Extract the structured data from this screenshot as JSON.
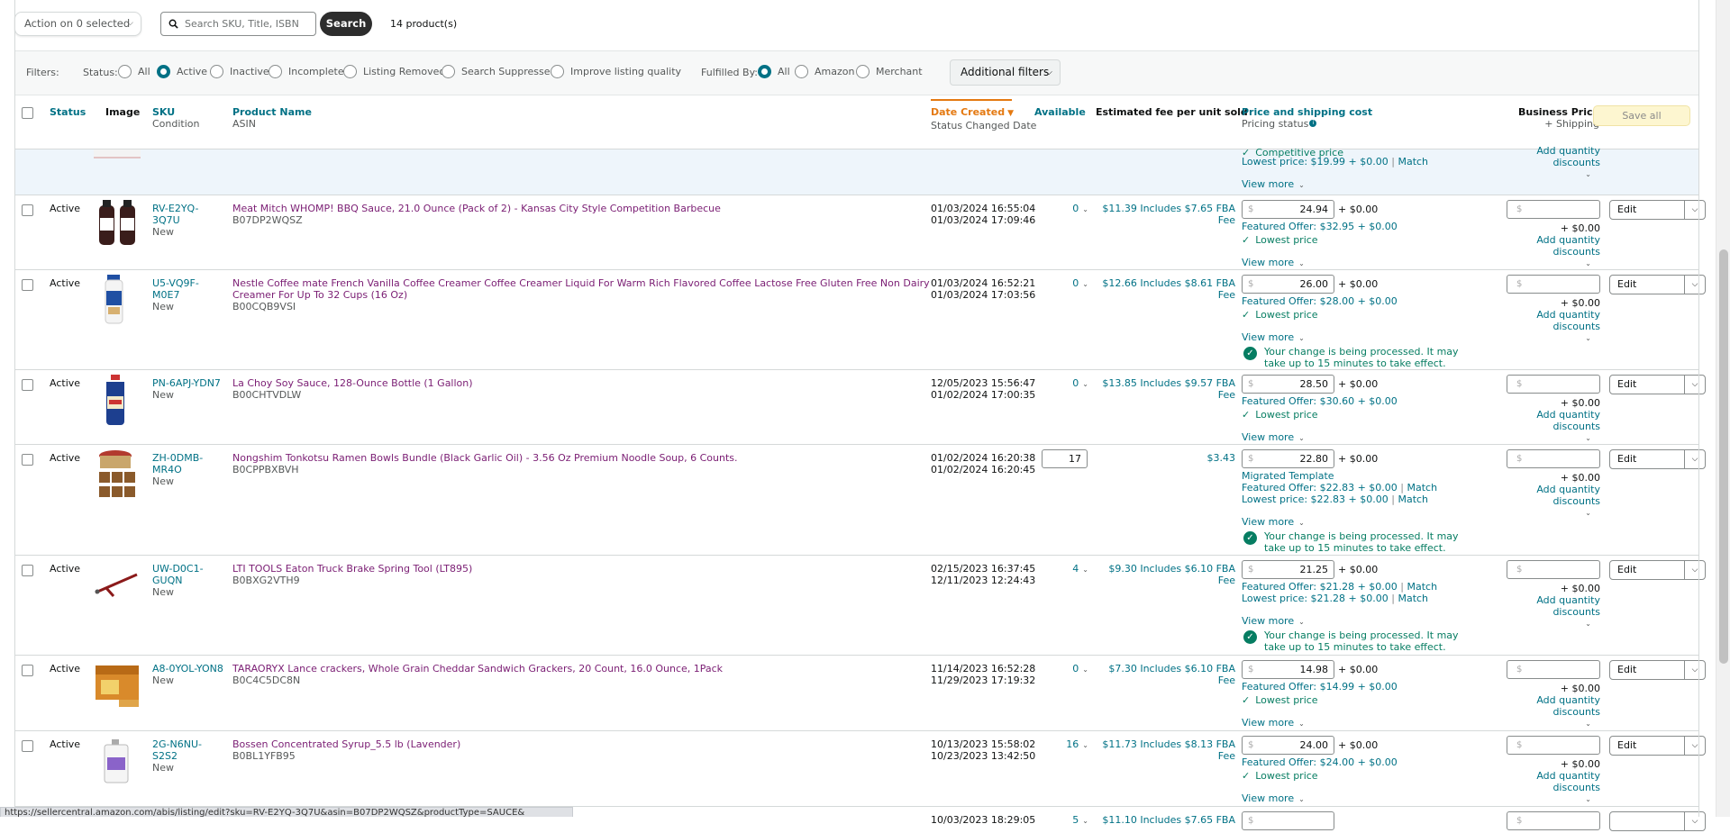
{
  "toolbar": {
    "action_label": "Action on 0 selected",
    "search_placeholder": "Search SKU, Title, ISBN",
    "search_button": "Search",
    "product_count": "14 product(s)"
  },
  "filters": {
    "label": "Filters:",
    "status_label": "Status:",
    "status_options": [
      "All",
      "Active",
      "Inactive",
      "Incomplete",
      "Listing Removed",
      "Search Suppressed",
      "Improve listing quality"
    ],
    "status_selected": "Active",
    "fulfilled_label": "Fulfilled By:",
    "fulfilled_options": [
      "All",
      "Amazon",
      "Merchant"
    ],
    "fulfilled_selected": "All",
    "additional_filters": "Additional filters"
  },
  "table_header": {
    "status": "Status",
    "image": "Image",
    "sku": "SKU",
    "condition": "Condition",
    "product_name": "Product Name",
    "asin": "ASIN",
    "date_created": "Date Created",
    "status_changed": "Status Changed Date",
    "available": "Available",
    "est_fee": "Estimated fee per unit sold",
    "price_shipping": "Price and shipping cost",
    "pricing_status": "Pricing status",
    "business_price": "Business Price",
    "plus_shipping": "+ Shipping",
    "save_all": "Save all"
  },
  "partial_row": {
    "competitive": "Competitive price",
    "lowest": "Lowest price: $19.99 + $0.00",
    "match": "Match",
    "view_more": "View more",
    "aqd": "Add quantity discounts"
  },
  "rows": [
    {
      "status": "Active",
      "sku": "RV-E2YQ-3Q7U",
      "condition": "New",
      "name": "Meat Mitch WHOMP! BBQ Sauce, 21.0 Ounce (Pack of 2) - Kansas City Style Competition Barbecue",
      "asin": "B07DP2WQSZ",
      "created": "01/03/2024 16:55:04",
      "changed": "01/03/2024 17:09:46",
      "available": "0",
      "fee": "$11.39 Includes $7.65 FBA Fee",
      "price": "24.94",
      "shipping": "+ $0.00",
      "featured": "Featured Offer: $32.95 + $0.00",
      "lowest_label": "Lowest price",
      "view_more": "View more",
      "bp_ship": "+ $0.00",
      "aqd": "Add quantity discounts",
      "edit": "Edit"
    },
    {
      "status": "Active",
      "sku": "U5-VQ9F-M0E7",
      "condition": "New",
      "name": "Nestle Coffee mate French Vanilla Coffee Creamer Coffee Creamer Liquid For Warm Rich Flavored Coffee Lactose Free Gluten Free Non Dairy Creamer For Up To 32 Cups (16 Oz)",
      "asin": "B00CQB9VSI",
      "created": "01/03/2024 16:52:21",
      "changed": "01/03/2024 17:03:56",
      "available": "0",
      "fee": "$12.66 Includes $8.61 FBA Fee",
      "price": "26.00",
      "shipping": "+ $0.00",
      "featured": "Featured Offer: $28.00 + $0.00",
      "lowest_label": "Lowest price",
      "view_more": "View more",
      "msg": "Your change is being processed. It may take up to 15 minutes to take effect.",
      "bp_ship": "+ $0.00",
      "aqd": "Add quantity discounts",
      "edit": "Edit"
    },
    {
      "status": "Active",
      "sku": "PN-6APJ-YDN7",
      "condition": "New",
      "name": "La Choy Soy Sauce, 128-Ounce Bottle (1 Gallon)",
      "asin": "B00CHTVDLW",
      "created": "12/05/2023 15:56:47",
      "changed": "01/02/2024 17:00:35",
      "available": "0",
      "fee": "$13.85 Includes $9.57 FBA Fee",
      "price": "28.50",
      "shipping": "+ $0.00",
      "featured": "Featured Offer: $30.60 + $0.00",
      "lowest_label": "Lowest price",
      "view_more": "View more",
      "bp_ship": "+ $0.00",
      "aqd": "Add quantity discounts",
      "edit": "Edit"
    },
    {
      "status": "Active",
      "sku": "ZH-0DMB-MR4O",
      "condition": "New",
      "name": "Nongshim Tonkotsu Ramen Bowls Bundle (Black Garlic Oil) - 3.56 Oz Premium Noodle Soup, 6 Counts.",
      "asin": "B0CPPBXBVH",
      "created": "01/02/2024 16:20:38",
      "changed": "01/02/2024 16:20:45",
      "available": "17",
      "fee": "$3.43",
      "price": "22.80",
      "shipping": "+ $0.00",
      "template": "Migrated Template",
      "featured": "Featured Offer: $22.83 + $0.00",
      "featured_match": "Match",
      "lowest_text": "Lowest price: $22.83 + $0.00",
      "lowest_match": "Match",
      "view_more": "View more",
      "msg": "Your change is being processed. It may take up to 15 minutes to take effect.",
      "bp_ship": "+ $0.00",
      "aqd": "Add quantity discounts",
      "edit": "Edit"
    },
    {
      "status": "Active",
      "sku": "UW-D0C1-GUQN",
      "condition": "New",
      "name": "LTI TOOLS Eaton Truck Brake Spring Tool (LT895)",
      "asin": "B0BXG2VTH9",
      "created": "02/15/2023 16:37:45",
      "changed": "12/11/2023 12:24:43",
      "available": "4",
      "fee": "$9.30 Includes $6.10 FBA Fee",
      "price": "21.25",
      "shipping": "+ $0.00",
      "featured": "Featured Offer: $21.28 + $0.00",
      "featured_match": "Match",
      "lowest_text": "Lowest price: $21.28 + $0.00",
      "lowest_match": "Match",
      "view_more": "View more",
      "msg": "Your change is being processed. It may take up to 15 minutes to take effect.",
      "bp_ship": "+ $0.00",
      "aqd": "Add quantity discounts",
      "edit": "Edit"
    },
    {
      "status": "Active",
      "sku": "A8-0YOL-YON8",
      "condition": "New",
      "name": "TARAORYX Lance crackers, Whole Grain Cheddar Sandwich Grackers, 20 Count, 16.0 Ounce, 1Pack",
      "asin": "B0C4C5DC8N",
      "created": "11/14/2023 16:52:28",
      "changed": "11/29/2023 17:19:32",
      "available": "0",
      "fee": "$7.30 Includes $6.10 FBA Fee",
      "price": "14.98",
      "shipping": "+ $0.00",
      "featured": "Featured Offer: $14.99 + $0.00",
      "lowest_label": "Lowest price",
      "view_more": "View more",
      "bp_ship": "+ $0.00",
      "aqd": "Add quantity discounts",
      "edit": "Edit"
    },
    {
      "status": "Active",
      "sku": "2G-N6NU-S2S2",
      "condition": "New",
      "name": "Bossen Concentrated Syrup_5.5 lb (Lavender)",
      "asin": "B0BL1YFB95",
      "created": "10/13/2023 15:58:02",
      "changed": "10/23/2023 13:42:50",
      "available": "16",
      "fee": "$11.73 Includes $8.13 FBA Fee",
      "price": "24.00",
      "shipping": "+ $0.00",
      "featured": "Featured Offer: $24.00 + $0.00",
      "lowest_label": "Lowest price",
      "view_more": "View more",
      "bp_ship": "+ $0.00",
      "aqd": "Add quantity discounts",
      "edit": "Edit"
    }
  ],
  "last_row_partial": {
    "created": "10/03/2023 18:29:05",
    "available": "5",
    "fee": "$11.10 Includes $7.65 FBA"
  },
  "status_url": "https://sellercentral.amazon.com/abis/listing/edit?sku=RV-E2YQ-3Q7U&asin=B07DP2WQSZ&productType=SAUCE&",
  "colors": {
    "link": "#007185",
    "title": "#7a1d73",
    "success": "#067d62",
    "sort_active": "#e47911"
  }
}
